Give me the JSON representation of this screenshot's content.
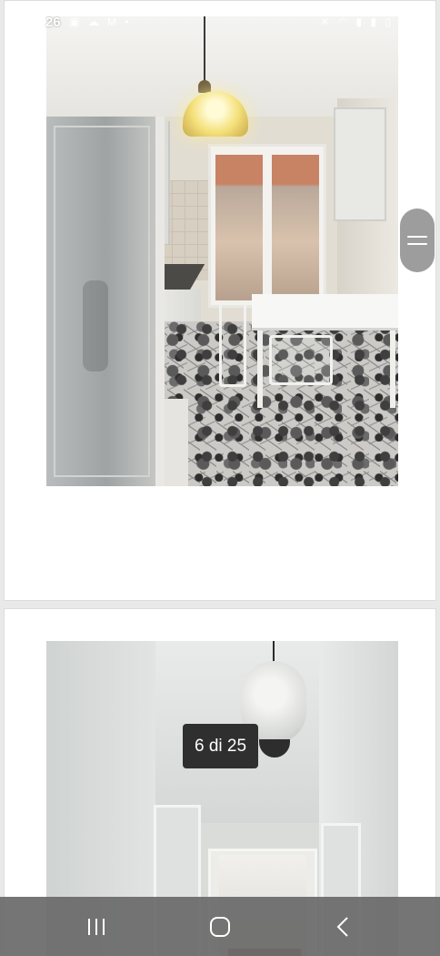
{
  "status_bar": {
    "time": "26",
    "left_icons": [
      "gallery-icon",
      "cloud-icon",
      "gmail-icon",
      "dot-icon"
    ],
    "right_icons": [
      "mute-icon",
      "wifi-icon",
      "signal-icon",
      "signal-icon",
      "battery-icon"
    ]
  },
  "gallery": {
    "counter": "6 di 25",
    "photos": [
      {
        "subject": "kitchen"
      },
      {
        "subject": "hallway"
      }
    ]
  },
  "side_handle": {
    "icon": "drag-handle-icon"
  },
  "nav_bar": {
    "buttons": [
      "recents-icon",
      "home-icon",
      "back-icon"
    ]
  },
  "colors": {
    "background": "#e9e9e9",
    "card": "#ffffff",
    "badge": "#2f2f2f",
    "handle": "#9d9d9d",
    "nav_bar": "#696969"
  }
}
